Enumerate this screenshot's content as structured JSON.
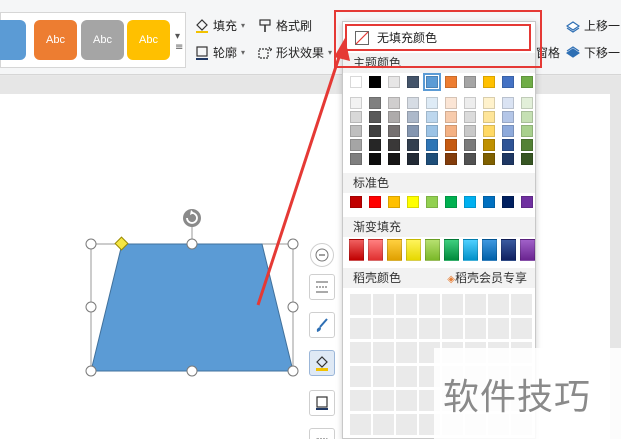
{
  "ribbon": {
    "style_tiles": [
      {
        "label": "",
        "color": "#5b9bd5"
      },
      {
        "label": "Abc",
        "color": "#ed7d31"
      },
      {
        "label": "Abc",
        "color": "#a5a5a5"
      },
      {
        "label": "Abc",
        "color": "#ffc000"
      }
    ],
    "fill_label": "填充",
    "format_painter_label": "格式刷",
    "outline_label": "轮廓",
    "shape_effects_label": "形状效果",
    "pane_label": "窗格",
    "move_up_label": "上移一",
    "move_down_label": "下移一"
  },
  "fill_menu": {
    "no_fill_label": "无填充颜色",
    "theme_colors_label": "主题颜色",
    "theme_top_row": [
      "#ffffff",
      "#000000",
      "#e7e6e6",
      "#44546a",
      "#5b9bd5",
      "#ed7d31",
      "#a5a5a5",
      "#ffc000",
      "#4472c4",
      "#70ad47"
    ],
    "theme_selected_index": 4,
    "theme_shades": [
      [
        "#f2f2f2",
        "#808080",
        "#d0cece",
        "#d6dce4",
        "#deebf6",
        "#fbe5d5",
        "#ededed",
        "#fff2cc",
        "#dae3f3",
        "#e2efd9"
      ],
      [
        "#d8d8d8",
        "#595959",
        "#aeabab",
        "#adb9ca",
        "#bdd7ee",
        "#f7cbac",
        "#dbdbdb",
        "#fee599",
        "#b4c6e7",
        "#c5e0b3"
      ],
      [
        "#bfbfbf",
        "#404040",
        "#757070",
        "#8496b0",
        "#9cc3e5",
        "#f4b183",
        "#c9c9c9",
        "#ffd965",
        "#8eaadb",
        "#a8d08d"
      ],
      [
        "#a5a5a5",
        "#262626",
        "#3a3838",
        "#323f4f",
        "#2e75b5",
        "#c55a11",
        "#7b7b7b",
        "#bf9000",
        "#2f5496",
        "#538135"
      ],
      [
        "#7f7f7f",
        "#0d0d0d",
        "#171616",
        "#222a35",
        "#1e4e79",
        "#833c0b",
        "#525252",
        "#7f6000",
        "#1f3864",
        "#375623"
      ]
    ],
    "standard_colors_label": "标准色",
    "standard_colors": [
      "#c00000",
      "#ff0000",
      "#ffc000",
      "#ffff00",
      "#92d050",
      "#00b050",
      "#00b0f0",
      "#0070c0",
      "#002060",
      "#7030a0"
    ],
    "gradient_fill_label": "渐变填充",
    "gradient_colors": [
      [
        "#c00000",
        "#f06060"
      ],
      [
        "#e03030",
        "#ff8080"
      ],
      [
        "#e0a000",
        "#ffd040"
      ],
      [
        "#e6d800",
        "#fff45c"
      ],
      [
        "#7ab828",
        "#b6e070"
      ],
      [
        "#008a3c",
        "#3fcf7f"
      ],
      [
        "#0090c8",
        "#4fd0ff"
      ],
      [
        "#0060a8",
        "#3f98e0"
      ],
      [
        "#102060",
        "#3a5aa0"
      ],
      [
        "#6a2490",
        "#a060c8"
      ]
    ],
    "docer_colors_label": "稻壳颜色",
    "docer_member_label": "稻壳会员专享"
  },
  "watermark_text": "软件技巧",
  "colors": {
    "shape_fill": "#5b9bd5",
    "annotation": "#e53935"
  }
}
